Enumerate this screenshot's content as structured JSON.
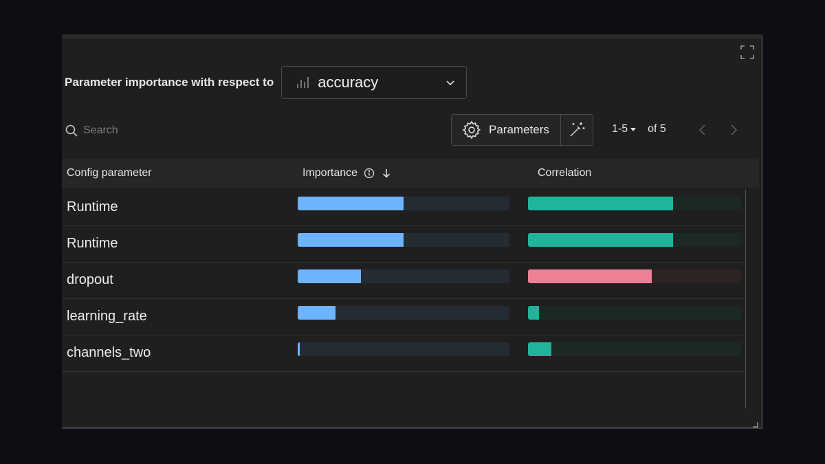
{
  "header": {
    "title": "Parameter importance with respect to",
    "metric": {
      "label": "accuracy",
      "icon": "bar-chart-icon"
    }
  },
  "toolbar": {
    "search_placeholder": "Search",
    "parameters_label": "Parameters",
    "pager": {
      "range": "1-5",
      "of": "of 5"
    }
  },
  "table": {
    "columns": [
      "Config parameter",
      "Importance",
      "Correlation"
    ],
    "sort": {
      "column": "Importance",
      "direction": "descending"
    },
    "rows": [
      {
        "name": "Runtime",
        "importance": 0.5,
        "correlation": 0.68
      },
      {
        "name": "Runtime",
        "importance": 0.5,
        "correlation": 0.68
      },
      {
        "name": "dropout",
        "importance": 0.3,
        "correlation": -0.58
      },
      {
        "name": "learning_rate",
        "importance": 0.18,
        "correlation": 0.05
      },
      {
        "name": "channels_two",
        "importance": 0.01,
        "correlation": 0.11
      }
    ]
  },
  "colors": {
    "importance": "#6cb4ff",
    "importance_track": "#252b33",
    "positive": "#20b49b",
    "positive_track": "#1b2826",
    "negative": "#ee8095",
    "negative_track": "#2c2323"
  }
}
